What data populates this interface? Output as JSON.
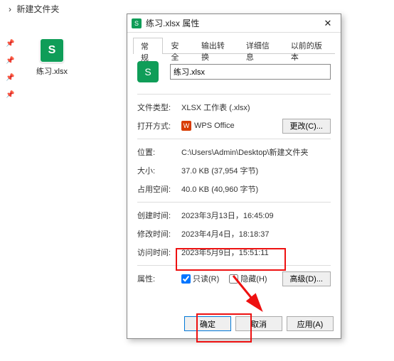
{
  "breadcrumb": {
    "sep": "›",
    "folder": "新建文件夹"
  },
  "desktop": {
    "filename": "练习.xlsx"
  },
  "dialog": {
    "title": "练习.xlsx 属性",
    "tabs": [
      "常规",
      "安全",
      "输出转换",
      "详细信息",
      "以前的版本"
    ],
    "filename": "练习.xlsx",
    "rows": {
      "filetype_label": "文件类型:",
      "filetype_value": "XLSX 工作表 (.xlsx)",
      "openwith_label": "打开方式:",
      "openwith_value": "WPS Office",
      "change_btn": "更改(C)...",
      "location_label": "位置:",
      "location_value": "C:\\Users\\Admin\\Desktop\\新建文件夹",
      "size_label": "大小:",
      "size_value": "37.0 KB (37,954 字节)",
      "sizedisk_label": "占用空间:",
      "sizedisk_value": "40.0 KB (40,960 字节)",
      "created_label": "创建时间:",
      "created_value": "2023年3月13日，16:45:09",
      "modified_label": "修改时间:",
      "modified_value": "2023年4月4日，18:18:37",
      "accessed_label": "访问时间:",
      "accessed_value": "2023年5月9日，15:51:11",
      "attr_label": "属性:",
      "readonly_label": "只读(R)",
      "hidden_label": "隐藏(H)",
      "advanced_btn": "高级(D)..."
    },
    "footer": {
      "ok": "确定",
      "cancel": "取消",
      "apply": "应用(A)"
    }
  }
}
